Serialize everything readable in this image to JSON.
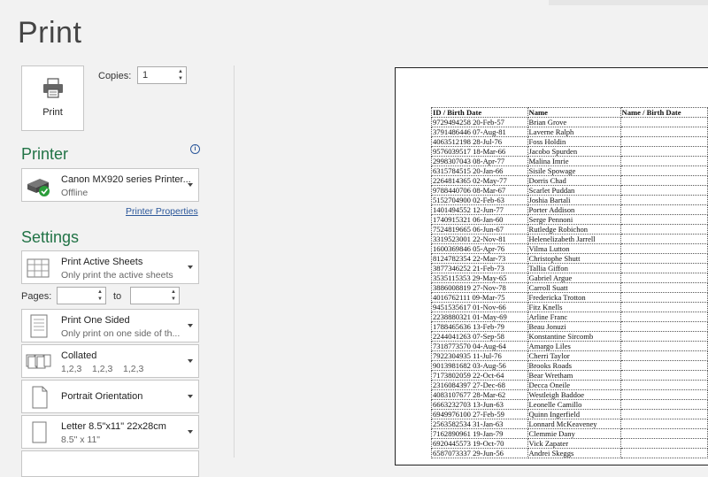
{
  "page_title": "Print",
  "print_button": {
    "label": "Print"
  },
  "copies": {
    "label": "Copies:",
    "value": "1"
  },
  "printer": {
    "heading": "Printer",
    "name": "Canon MX920 series Printer...",
    "status": "Offline",
    "properties_link": "Printer Properties"
  },
  "settings": {
    "heading": "Settings",
    "scope": {
      "title": "Print Active Sheets",
      "subtitle": "Only print the active sheets"
    },
    "pages_label": "Pages:",
    "to_label": "to",
    "sides": {
      "title": "Print One Sided",
      "subtitle": "Only print on one side of th..."
    },
    "collation": {
      "title": "Collated",
      "subtitle": "1,2,3    1,2,3    1,2,3"
    },
    "orientation": {
      "title": "Portrait Orientation"
    },
    "paper": {
      "title": "Letter 8.5\"x11\" 22x28cm",
      "subtitle": "8.5\" x 11\""
    }
  },
  "preview": {
    "headers": [
      "ID / Birth Date",
      "Name",
      "Name / Birth Date"
    ],
    "rows": [
      [
        "9729494258 20-Feb-57",
        "Brian Grove",
        ""
      ],
      [
        "3791486446 07-Aug-81",
        "Laverne Ralph",
        ""
      ],
      [
        "4063512198 28-Jul-76",
        "Foss Holdin",
        ""
      ],
      [
        "9576039517 18-Mar-66",
        "Jacobo Spurden",
        ""
      ],
      [
        "2998307043 08-Apr-77",
        "Malina Imrie",
        ""
      ],
      [
        "6315784515 20-Jan-66",
        "Sisile Spowage",
        ""
      ],
      [
        "2264814365 02-May-77",
        "Dorris Chad",
        ""
      ],
      [
        "9788440706 08-Mar-67",
        "Scarlet Puddan",
        ""
      ],
      [
        "5152704900 02-Feb-63",
        "Joshia Bartali",
        ""
      ],
      [
        "1401494552 12-Jun-77",
        "Porter Addison",
        ""
      ],
      [
        "1740915321 06-Jan-60",
        "Serge Pennoni",
        ""
      ],
      [
        "7524819665 06-Jun-67",
        "Rutledge Robichon",
        ""
      ],
      [
        "3319523001 22-Nov-81",
        "Helenelizabeth Jarrell",
        ""
      ],
      [
        "1600369846 05-Apr-76",
        "Vilma Lutton",
        ""
      ],
      [
        "8124782354 22-Mar-73",
        "Christophe Shutt",
        ""
      ],
      [
        "3877346252 21-Feb-73",
        "Tallia Giffon",
        ""
      ],
      [
        "3535115353 29-May-65",
        "Gabriel Argue",
        ""
      ],
      [
        "3886008819 27-Nov-78",
        "Carroll Suatt",
        ""
      ],
      [
        "4016762111 09-Mar-75",
        "Fredericka Trotton",
        ""
      ],
      [
        "9451535617 01-Nov-66",
        "Fitz Knells",
        ""
      ],
      [
        "2238880321 01-May-69",
        "Arline Franc",
        ""
      ],
      [
        "1788465636 13-Feb-79",
        "Beau Jonuzi",
        ""
      ],
      [
        "2244041263 07-Sep-58",
        "Konstantine Sircomb",
        ""
      ],
      [
        "7318773570 04-Aug-64",
        "Amargo Liles",
        ""
      ],
      [
        "7922304935 11-Jul-76",
        "Cherri Taylor",
        ""
      ],
      [
        "9013981682 03-Aug-56",
        "Brooks Roads",
        ""
      ],
      [
        "7173802059 22-Oct-64",
        "Bear Wretham",
        ""
      ],
      [
        "2316084397 27-Dec-68",
        "Decca Oneile",
        ""
      ],
      [
        "4083107677 28-Mar-62",
        "Westleigh Baddoe",
        ""
      ],
      [
        "6663232703 13-Jun-63",
        "Leonelle Camillo",
        ""
      ],
      [
        "6949976100 27-Feb-59",
        "Quinn Ingerfield",
        ""
      ],
      [
        "2563582534 31-Jan-63",
        "Lonnard McKeaveney",
        ""
      ],
      [
        "7162890961 19-Jan-79",
        "Clemmie Dany",
        ""
      ],
      [
        "6920445573 19-Oct-70",
        "Vick Zapater",
        ""
      ],
      [
        "6587073337 29-Jun-56",
        "Andrei Skeggs",
        ""
      ]
    ]
  }
}
